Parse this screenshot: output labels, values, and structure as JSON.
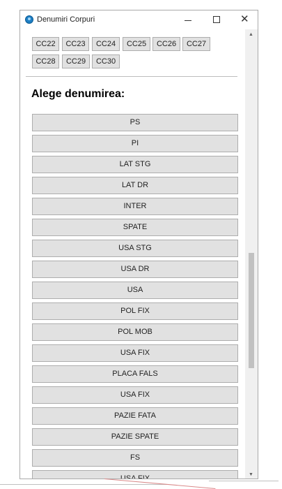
{
  "window": {
    "title": "Denumiri Corpuri",
    "close_glyph": "✕"
  },
  "chips": [
    "CC22",
    "CC23",
    "CC24",
    "CC25",
    "CC26",
    "CC27",
    "CC28",
    "CC29",
    "CC30"
  ],
  "heading": "Alege denumirea:",
  "options": [
    "PS",
    "PI",
    "LAT STG",
    "LAT DR",
    "INTER",
    "SPATE",
    "USA STG",
    "USA DR",
    "USA",
    "POL FIX",
    "POL MOB",
    "USA FIX",
    "PLACA FALS",
    "USA FIX",
    "PAZIE FATA",
    "PAZIE SPATE",
    "FS",
    "USA FIX"
  ],
  "scrollbar": {
    "up": "▲",
    "down": "▼"
  },
  "colors": {
    "app_icon": "#1e7fc4",
    "button_face": "#e1e1e1",
    "button_border": "#adadad"
  }
}
